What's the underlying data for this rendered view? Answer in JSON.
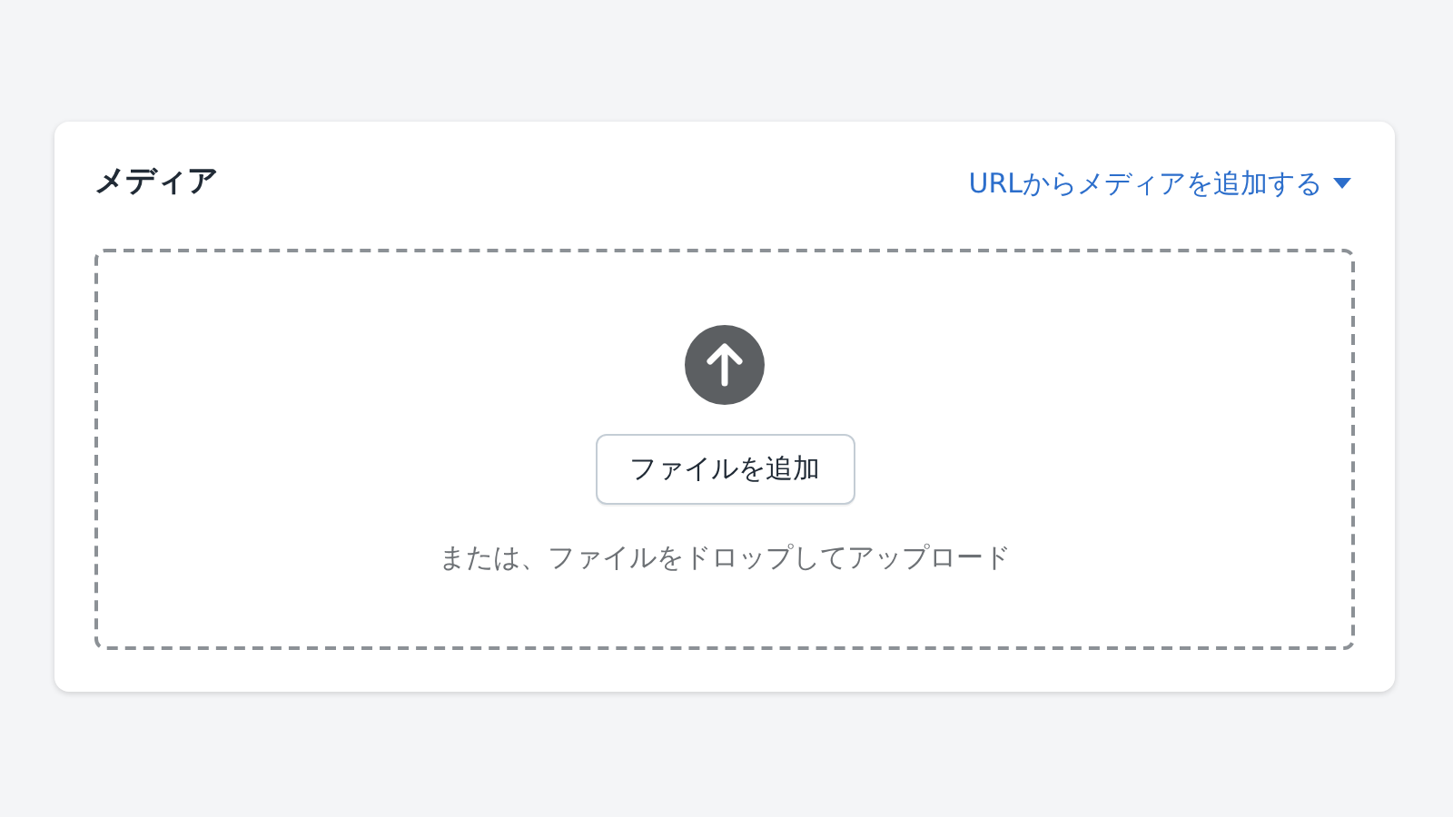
{
  "card": {
    "title": "メディア",
    "add_from_url": {
      "label": "URLからメディアを追加する"
    }
  },
  "dropzone": {
    "button": "ファイルを追加",
    "hint": "または、ファイルをドロップしてアップロード"
  }
}
